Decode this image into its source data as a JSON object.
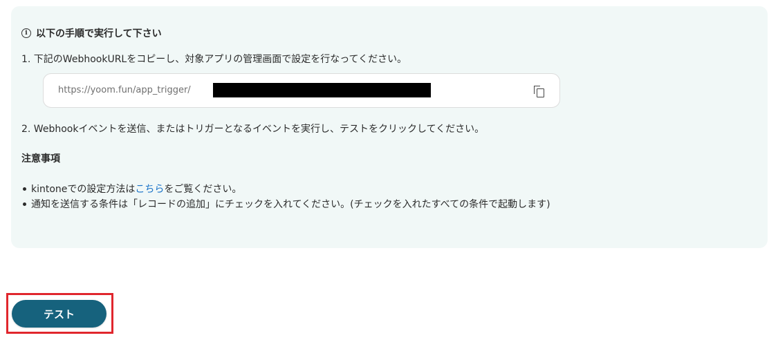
{
  "instructions": {
    "heading": "以下の手順で実行して下さい",
    "step1": "1. 下記のWebhookURLをコピーし、対象アプリの管理画面で設定を行なってください。",
    "url_prefix": "https://yoom.fun/app_trigger/",
    "step2": "2. Webhookイベントを送信、またはトリガーとなるイベントを実行し、テストをクリックしてください。"
  },
  "notes": {
    "title": "注意事項",
    "item1_before": "kintoneでの設定方法は",
    "item1_link": "こちら",
    "item1_after": "をご覧ください。",
    "item2": "通知を送信する条件は「レコードの追加」にチェックを入れてください。(チェックを入れたすべての条件で起動します)"
  },
  "buttons": {
    "test_label": "テスト"
  },
  "icons": {
    "info": "info-icon",
    "copy": "copy-icon"
  },
  "colors": {
    "panel_bg": "#f1f8f7",
    "button_bg": "#16627d",
    "link": "#1a73c8",
    "highlight": "#e0262d"
  }
}
